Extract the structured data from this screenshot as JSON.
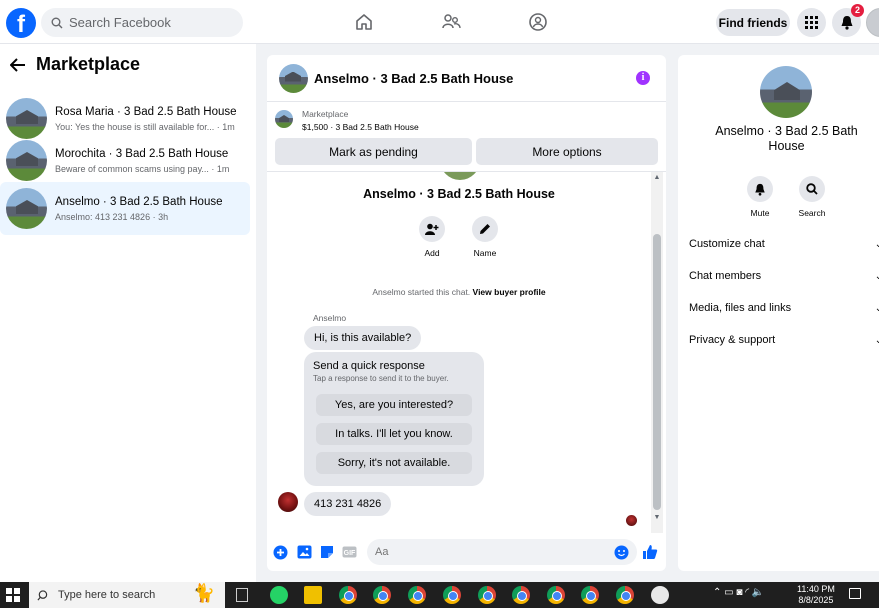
{
  "topbar": {
    "logo": "f",
    "search_placeholder": "Search Facebook",
    "find_friends": "Find friends",
    "notification_count": "2"
  },
  "sidebar": {
    "title": "Marketplace",
    "conversations": [
      {
        "name": "Rosa Maria · 3 Bad 2.5 Bath House",
        "preview": "You: Yes the house is still available for... · 1m"
      },
      {
        "name": "Morochita · 3 Bad 2.5 Bath House",
        "preview": "Beware of common scams using pay... · 1m"
      },
      {
        "name": "Anselmo · 3 Bad 2.5 Bath House",
        "preview": "Anselmo: 413 231 4826 · 3h"
      }
    ]
  },
  "chat": {
    "title": "Anselmo · 3 Bad 2.5 Bath House",
    "listing_source": "Marketplace",
    "listing_price": "$1,500 · 3 Bad 2.5 Bath House",
    "mark_pending": "Mark as pending",
    "more_options": "More options",
    "center_name": "Anselmo · 3 Bad 2.5 Bath House",
    "add_label": "Add",
    "name_label": "Name",
    "started_text": "Anselmo started this chat.",
    "view_profile": "View buyer profile",
    "sender": "Anselmo",
    "msg1": "Hi, is this available?",
    "quick_title": "Send a quick response",
    "quick_sub": "Tap a response to send it to the buyer.",
    "quick_responses": [
      "Yes, are you interested?",
      "In talks. I'll let you know.",
      "Sorry, it's not available."
    ],
    "msg2": "413 231 4826",
    "composer_placeholder": "Aa"
  },
  "right_panel": {
    "name": "Anselmo · 3 Bad 2.5 Bath House",
    "mute": "Mute",
    "search": "Search",
    "rows": [
      "Customize chat",
      "Chat members",
      "Media, files and links",
      "Privacy & support"
    ]
  },
  "taskbar": {
    "search_text": "Type here to search",
    "time": "11:40 PM",
    "date": "8/8/2025"
  },
  "colors": {
    "brand": "#0866ff",
    "active_conv": "#ebf5ff",
    "badge": "#e41e3f",
    "info": "#a033ff"
  }
}
